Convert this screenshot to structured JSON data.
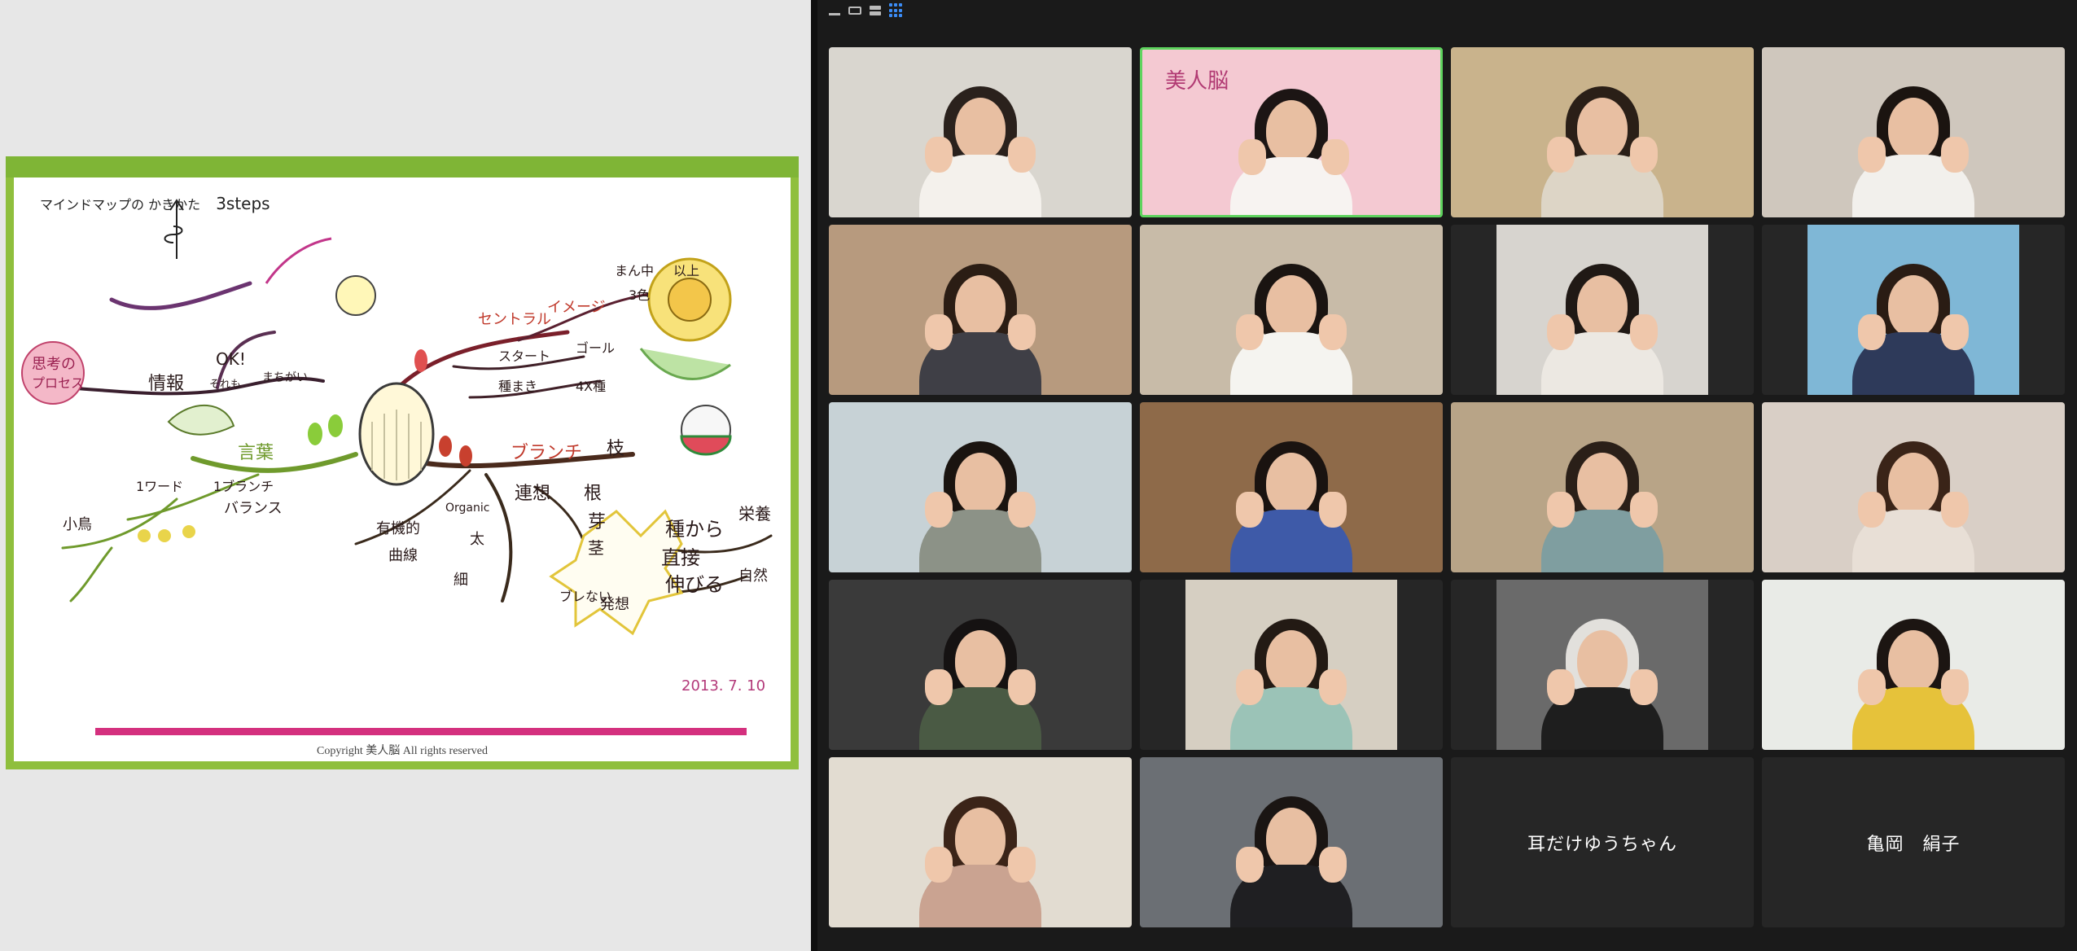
{
  "slide": {
    "heading": "マインドマップの かきかた",
    "steps": "3steps",
    "copyright": "Copyright 美人脳 All rights reserved",
    "mindmap_labels": [
      "思考の",
      "プロセス",
      "情報",
      "それも",
      "OK!",
      "まちがい",
      "セントラル",
      "イメージ",
      "スタート",
      "ゴール",
      "種まき",
      "4X種",
      "まん中",
      "3色",
      "以上",
      "言葉",
      "1ワード",
      "1ブランチ",
      "バランス",
      "小鳥",
      "有機的",
      "曲線",
      "Organic",
      "太",
      "細",
      "ブランチ",
      "枝",
      "連想",
      "根",
      "芽",
      "茎",
      "種から",
      "直接",
      "伸びる",
      "栄養",
      "自然",
      "ブレない",
      "発想",
      "2013. 7. 10"
    ]
  },
  "zoom": {
    "view_controls": [
      "minimize-icon",
      "speaker-view-icon",
      "side-by-side-icon",
      "gallery-view-icon"
    ],
    "logo_text": "美人脳",
    "participants": [
      {
        "type": "video",
        "bg": "#d9d6cf",
        "hair": "#2a211c",
        "top": "#f4f1ec"
      },
      {
        "type": "video",
        "bg": "#f4c9d2",
        "hair": "#1c1514",
        "top": "#f7f3f1",
        "active": true,
        "logo": true
      },
      {
        "type": "video",
        "bg": "#c9b38c",
        "hair": "#2a1f17",
        "top": "#ddd5c6"
      },
      {
        "type": "video",
        "bg": "#cfc7bd",
        "hair": "#1b1410",
        "top": "#f2f0ec"
      },
      {
        "type": "video",
        "bg": "#b79a7e",
        "hair": "#2b1d14",
        "top": "#3f3f46"
      },
      {
        "type": "video",
        "bg": "#c8bba8",
        "hair": "#1a1411",
        "top": "#f5f4f0"
      },
      {
        "type": "video",
        "bg": "#d7d4cf",
        "hair": "#201915",
        "top": "#ece8e2",
        "inset": true
      },
      {
        "type": "video",
        "bg": "#7fb7d6",
        "hair": "#2a1c14",
        "top": "#2e3a5a",
        "inset": true
      },
      {
        "type": "video",
        "bg": "#c7d2d6",
        "hair": "#1a1410",
        "top": "#8c9287"
      },
      {
        "type": "video",
        "bg": "#8e6a49",
        "hair": "#1a1310",
        "top": "#3e5aa8"
      },
      {
        "type": "video",
        "bg": "#b8a487",
        "hair": "#2a1f18",
        "top": "#7f9ea0"
      },
      {
        "type": "video",
        "bg": "#d9cfc6",
        "hair": "#3a2418",
        "top": "#e8dfd6"
      },
      {
        "type": "video",
        "bg": "#3a3a3a",
        "hair": "#151212",
        "top": "#4a5a44"
      },
      {
        "type": "video",
        "bg": "#d6cfc2",
        "hair": "#231a14",
        "top": "#9bc3b7",
        "inset": true
      },
      {
        "type": "video",
        "bg": "#6a6a6a",
        "hair": "#e2e0dc",
        "top": "#1e1e1e",
        "inset": true
      },
      {
        "type": "video",
        "bg": "#e9ebe7",
        "hair": "#1c1512",
        "top": "#e6c23a"
      },
      {
        "type": "video",
        "bg": "#e2dcd1",
        "hair": "#3b2418",
        "top": "#caa391"
      },
      {
        "type": "video",
        "bg": "#6b6f74",
        "hair": "#1a1513",
        "top": "#1f1f22"
      },
      {
        "type": "name",
        "name": "耳だけゆうちゃん"
      },
      {
        "type": "name",
        "name": "亀岡　絹子"
      }
    ]
  }
}
